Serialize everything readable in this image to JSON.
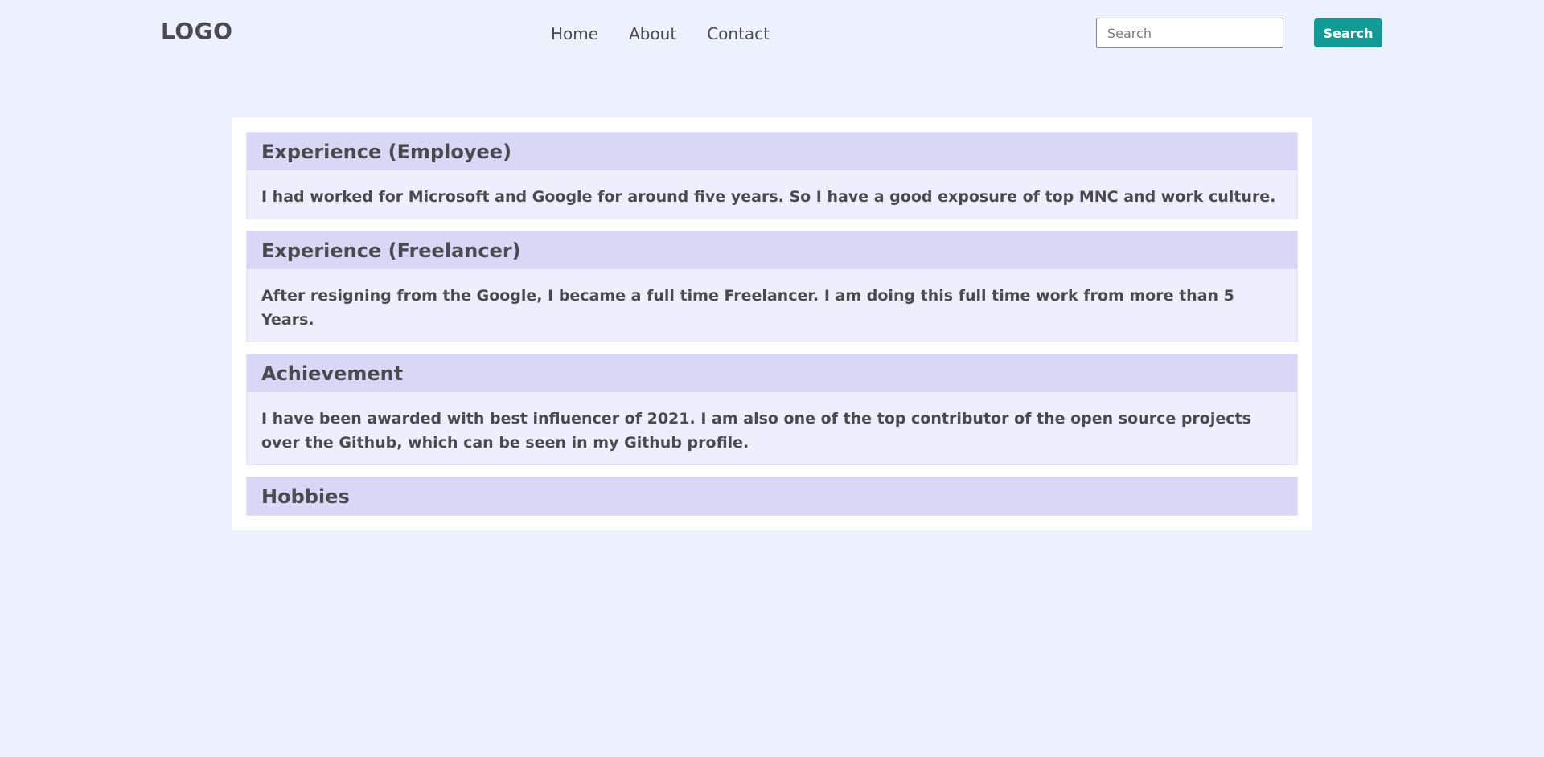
{
  "nav": {
    "logo": "LOGO",
    "links": [
      "Home",
      "About",
      "Contact"
    ],
    "search_placeholder": "Search",
    "search_button": "Search",
    "accent_color": "#139a96"
  },
  "sections": [
    {
      "title": "Experience (Employee)",
      "body": "I had worked for Microsoft and Google for around five years. So I have a good exposure of top MNC and work culture."
    },
    {
      "title": "Experience (Freelancer)",
      "body": "After resigning from the Google, I became a full time Freelancer. I am doing this full time work from more than 5 Years."
    },
    {
      "title": "Achievement",
      "body": "I have been awarded with best influencer of 2021. I am also one of the top contributor of the open source projects over the Github, which can be seen in my Github profile."
    },
    {
      "title": "Hobbies",
      "body": ""
    }
  ]
}
